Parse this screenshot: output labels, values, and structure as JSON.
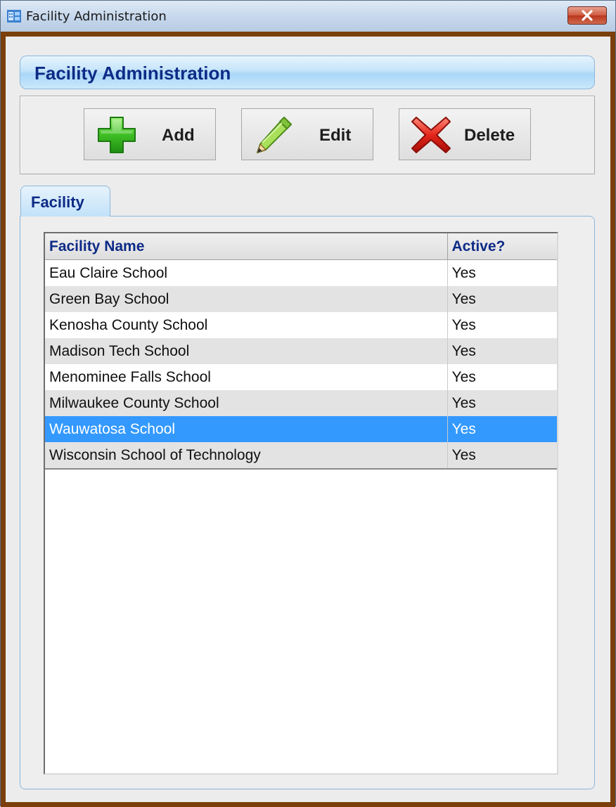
{
  "window": {
    "title": "Facility Administration",
    "close_glyph": "✕"
  },
  "header": {
    "title": "Facility Administration"
  },
  "toolbar": {
    "add_label": "Add",
    "edit_label": "Edit",
    "delete_label": "Delete"
  },
  "tabs": [
    {
      "label": "Facility"
    }
  ],
  "grid": {
    "columns": [
      "Facility Name",
      "Active?"
    ],
    "rows": [
      {
        "name": "Eau Claire School",
        "active": "Yes"
      },
      {
        "name": "Green Bay School",
        "active": "Yes"
      },
      {
        "name": "Kenosha County School",
        "active": "Yes"
      },
      {
        "name": "Madison Tech School",
        "active": "Yes"
      },
      {
        "name": "Menominee Falls School",
        "active": "Yes"
      },
      {
        "name": "Milwaukee County School",
        "active": "Yes"
      },
      {
        "name": "Wauwatosa School",
        "active": "Yes"
      },
      {
        "name": "Wisconsin School of Technology",
        "active": "Yes"
      }
    ],
    "selected_row": "Wauwatosa School"
  },
  "colors": {
    "accent": "#0d2b86",
    "selection": "#3399ff",
    "frame": "#7a3f0b"
  },
  "icons": [
    "app-window-icon",
    "close-icon",
    "plus-icon",
    "pencil-icon",
    "red-x-icon"
  ]
}
